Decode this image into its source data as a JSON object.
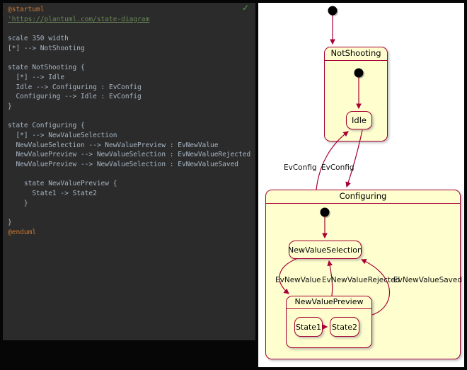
{
  "editor": {
    "background": "#2b2b2b",
    "default_text_color": "#a9b7c6",
    "directive_color": "#cc7832",
    "comment_color": "#6a8759",
    "check_icon": "✓",
    "check_color": "#4fa74f",
    "lines": [
      {
        "type": "directive",
        "text": "@startuml"
      },
      {
        "type": "comment",
        "text": "'https://plantuml.com/state-diagram"
      },
      {
        "type": "plain",
        "text": ""
      },
      {
        "type": "plain",
        "text": "scale 350 width"
      },
      {
        "type": "plain",
        "text": "[*] --> NotShooting"
      },
      {
        "type": "plain",
        "text": ""
      },
      {
        "type": "plain",
        "text": "state NotShooting {"
      },
      {
        "type": "plain",
        "text": "  [*] --> Idle"
      },
      {
        "type": "plain",
        "text": "  Idle --> Configuring : EvConfig"
      },
      {
        "type": "plain",
        "text": "  Configuring --> Idle : EvConfig"
      },
      {
        "type": "plain",
        "text": "}"
      },
      {
        "type": "plain",
        "text": ""
      },
      {
        "type": "plain",
        "text": "state Configuring {"
      },
      {
        "type": "plain",
        "text": "  [*] --> NewValueSelection"
      },
      {
        "type": "plain",
        "text": "  NewValueSelection --> NewValuePreview : EvNewValue"
      },
      {
        "type": "plain",
        "text": "  NewValuePreview --> NewValueSelection : EvNewValueRejected"
      },
      {
        "type": "plain",
        "text": "  NewValuePreview --> NewValueSelection : EvNewValueSaved"
      },
      {
        "type": "plain",
        "text": ""
      },
      {
        "type": "plain",
        "text": "    state NewValuePreview {"
      },
      {
        "type": "plain",
        "text": "      State1 -> State2"
      },
      {
        "type": "plain",
        "text": "    }"
      },
      {
        "type": "plain",
        "text": ""
      },
      {
        "type": "plain",
        "text": "}"
      },
      {
        "type": "directive",
        "text": "@enduml"
      }
    ]
  },
  "diagram": {
    "background": "#ffffff",
    "state_fill": "#fefece",
    "state_border": "#a80036",
    "arrow_color": "#a80036",
    "states": {
      "notshooting": "NotShooting",
      "idle": "Idle",
      "configuring": "Configuring",
      "newvalueselection": "NewValueSelection",
      "newvaluepreview": "NewValuePreview",
      "state1": "State1",
      "state2": "State2"
    },
    "edge_labels": {
      "evconfig_left": "EvConfig",
      "evconfig_right": "EvConfig",
      "evnewvalue": "EvNewValue",
      "evnewvaluerejected": "EvNewValueRejected",
      "evnewvaluesaved": "EvNewValueSaved"
    }
  }
}
